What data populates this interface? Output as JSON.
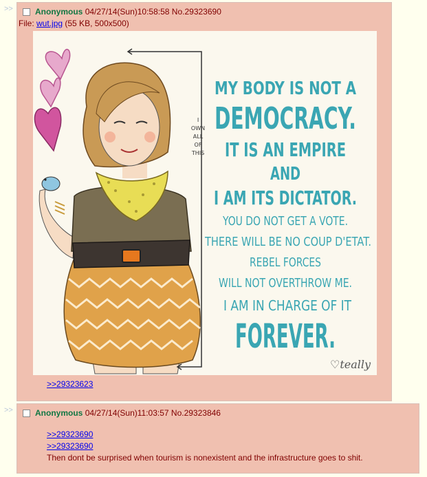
{
  "post1": {
    "arrow": ">>",
    "name": "Anonymous",
    "datetime": "04/27/14(Sun)10:58:58",
    "number": "No.29323690",
    "file_label": "File: ",
    "file_name": "wut.jpg",
    "file_meta": " (55 KB, 500x500)",
    "reply_link": ">>29323623",
    "image": {
      "side_note": [
        "I",
        "OWN",
        "ALL",
        "OF",
        "THIS"
      ],
      "lines": [
        "MY BODY IS NOT A",
        "DEMOCRACY.",
        "IT IS AN EMPIRE",
        "AND",
        "I AM ITS DICTATOR.",
        "YOU DO NOT GET A VOTE.",
        "THERE WILL BE NO COUP D'ETAT.",
        "REBEL FORCES",
        "WILL NOT OVERTHROW ME.",
        "I AM IN CHARGE OF IT",
        "FOREVER."
      ],
      "signature": "♡teally",
      "colors": {
        "text": "#3aa6b3",
        "hearts": "#d1559e",
        "skirt": "#e0a24a",
        "scarf": "#e8dd55",
        "hair": "#c99a55"
      }
    }
  },
  "post2": {
    "arrow": ">>",
    "name": "Anonymous",
    "datetime": "04/27/14(Sun)11:03:57",
    "number": "No.29323846",
    "links": [
      ">>29323690",
      ">>29323690"
    ],
    "message": "Then dont be surprised when tourism is nonexistent and the infrastructure goes to shit."
  }
}
